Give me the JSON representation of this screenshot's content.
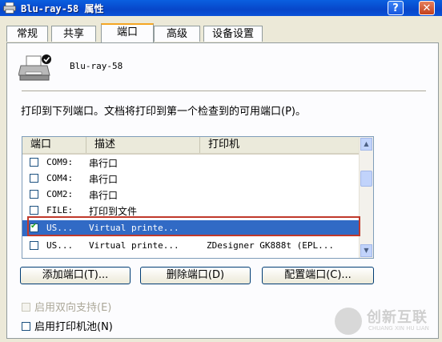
{
  "window": {
    "title": "Blu-ray-58 属性",
    "help_label": "?",
    "close_label": "✕"
  },
  "tabs": [
    {
      "label": "常规"
    },
    {
      "label": "共享"
    },
    {
      "label": "端口",
      "active": true
    },
    {
      "label": "高级"
    },
    {
      "label": "设备设置"
    }
  ],
  "printer": {
    "name": "Blu-ray-58",
    "icon": "printer-icon"
  },
  "instruction": "打印到下列端口。文档将打印到第一个检查到的可用端口(P)。",
  "port_list": {
    "columns": [
      "端口",
      "描述",
      "打印机"
    ],
    "rows": [
      {
        "port": "COM9:",
        "description": "串行口",
        "printer": "",
        "checked": false
      },
      {
        "port": "COM4:",
        "description": "串行口",
        "printer": "",
        "checked": false
      },
      {
        "port": "COM2:",
        "description": "串行口",
        "printer": "",
        "checked": false
      },
      {
        "port": "FILE:",
        "description": "打印到文件",
        "printer": "",
        "checked": false
      },
      {
        "port": "US...",
        "description": "Virtual printe...",
        "printer": "",
        "checked": true,
        "selected": true
      },
      {
        "port": "US...",
        "description": "Virtual printe...",
        "printer": "ZDesigner GK888t (EPL...",
        "checked": false
      }
    ]
  },
  "buttons": {
    "add_port": "添加端口(T)...",
    "delete_port": "删除端口(D)",
    "configure_port": "配置端口(C)..."
  },
  "options": {
    "bidirectional": "启用双向支持(E)",
    "printer_pool": "启用打印机池(N)"
  },
  "watermark": {
    "text": "创新互联",
    "sub": "CHUANG XIN HU LIAN"
  },
  "colors": {
    "titlebar": "#0746c9",
    "selection": "#316ac5",
    "highlight_box": "#c0392b",
    "active_tab": "#f5a623"
  }
}
